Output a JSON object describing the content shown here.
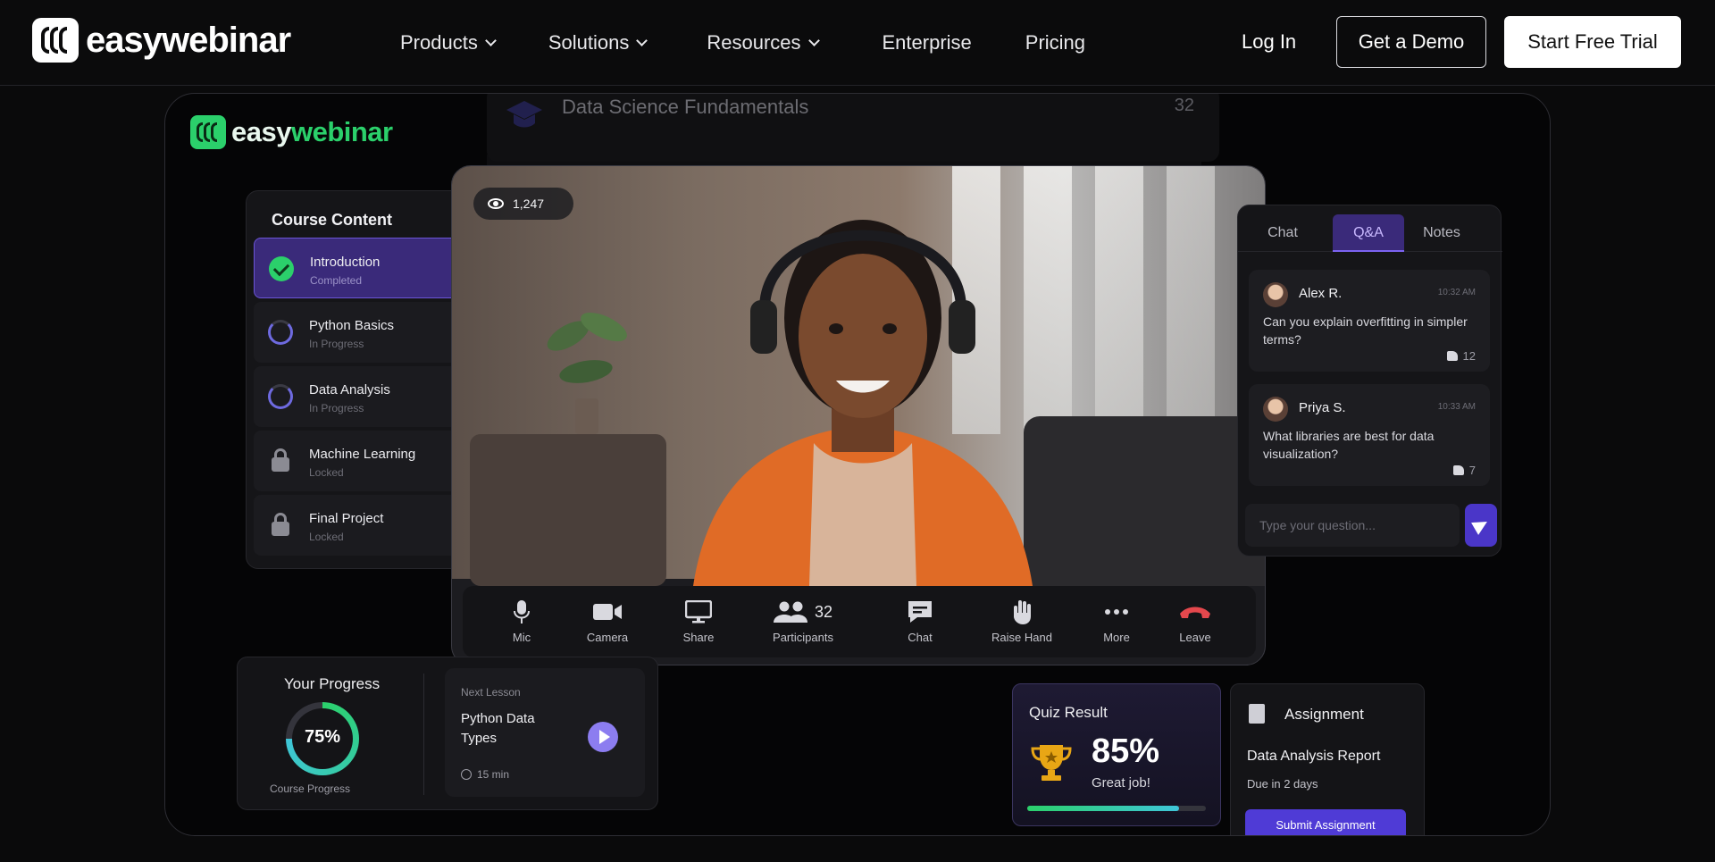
{
  "nav": {
    "brand": "easywebinar",
    "menu": [
      {
        "label": "Products",
        "dropdown": true
      },
      {
        "label": "Solutions",
        "dropdown": true
      },
      {
        "label": "Resources",
        "dropdown": true
      },
      {
        "label": "Enterprise",
        "dropdown": false
      },
      {
        "label": "Pricing",
        "dropdown": false
      }
    ],
    "login": "Log In",
    "demo": "Get a Demo",
    "trial": "Start Free Trial"
  },
  "hero": {
    "brand_a": "easy",
    "brand_b": "webinar",
    "course_header": {
      "title": "Data Science Fundamentals",
      "count": "32"
    },
    "course_content": {
      "title": "Course Content",
      "lessons": [
        {
          "name": "Introduction",
          "status": "Completed",
          "state": "completed"
        },
        {
          "name": "Python Basics",
          "status": "In Progress",
          "state": "progress"
        },
        {
          "name": "Data Analysis",
          "status": "In Progress",
          "state": "progress"
        },
        {
          "name": "Machine Learning",
          "status": "Locked",
          "state": "locked"
        },
        {
          "name": "Final Project",
          "status": "Locked",
          "state": "locked"
        }
      ]
    },
    "video": {
      "viewers": "1,247",
      "controls": [
        {
          "label": "Mic",
          "icon": "mic-icon"
        },
        {
          "label": "Camera",
          "icon": "camera-icon"
        },
        {
          "label": "Share",
          "icon": "screen-share-icon"
        },
        {
          "label": "Participants",
          "icon": "participants-icon",
          "count": "32"
        },
        {
          "label": "Chat",
          "icon": "chat-icon"
        },
        {
          "label": "Raise Hand",
          "icon": "raise-hand-icon"
        },
        {
          "label": "More",
          "icon": "more-icon"
        },
        {
          "label": "Leave",
          "icon": "leave-call-icon"
        }
      ]
    },
    "chat": {
      "tabs": [
        "Chat",
        "Q&A",
        "Notes"
      ],
      "active_tab": "Q&A",
      "messages": [
        {
          "name": "Alex R.",
          "time": "10:32 AM",
          "text": "Can you explain overfitting in simpler terms?",
          "likes": "12"
        },
        {
          "name": "Priya S.",
          "time": "10:33 AM",
          "text": "What libraries are best for data visualization?",
          "likes": "7"
        }
      ],
      "placeholder": "Type your question..."
    },
    "progress": {
      "title": "Your Progress",
      "percent": "75%",
      "fraction": 0.75,
      "sub": "Course Progress",
      "next_label": "Next Lesson",
      "next_title": "Python Data Types",
      "next_time": "15 min"
    },
    "quiz": {
      "title": "Quiz Result",
      "score": "85%",
      "fraction": 0.85,
      "note": "Great job!"
    },
    "assignment": {
      "title": "Assignment",
      "name": "Data Analysis Report",
      "due": "Due in 2 days",
      "button": "Submit Assignment"
    }
  },
  "colors": {
    "accent": "#4f3bd6",
    "brand_green": "#2bd06b",
    "leave_red": "#e5484d"
  }
}
